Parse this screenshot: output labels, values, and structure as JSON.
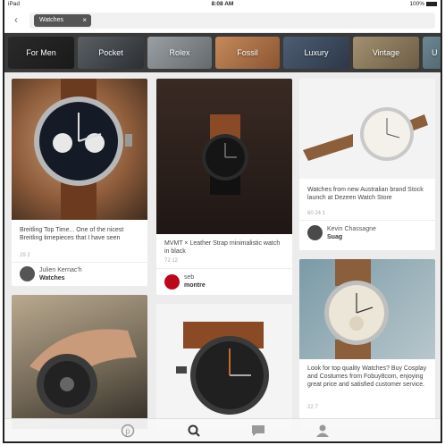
{
  "status": {
    "device": "iPad",
    "time": "8:08 AM",
    "battery": "100%"
  },
  "search": {
    "query": "Watches"
  },
  "categories": [
    "For Men",
    "Pocket",
    "Rolex",
    "Fossil",
    "Luxury",
    "Vintage",
    "U"
  ],
  "pins": [
    {
      "desc": "Breitling Top Time... One of the nicest Breitling timepieces that I have seen",
      "stats": "29  2",
      "user": "Julien Kernac'h",
      "board": "Watches"
    },
    {
      "desc": "MVMT × Leather Strap minimalistic watch in black",
      "stats": "72  12",
      "user": "seb",
      "board": "montre"
    },
    {
      "desc": "Watches from new Australian brand Stock launch at Dezeen Watch Store",
      "stats": "60  24  1",
      "user": "Kevin Chassagne",
      "board": "Suag"
    },
    {
      "desc": "Look for top quality Watches? Buy Cosplay and Costumes from Fobuy8com, enjoying great price and satisfied customer service.",
      "stats": "22  7"
    }
  ],
  "colors": {
    "accent": "#bd081c",
    "category_bar": "#3a3a3a"
  },
  "tabs": [
    "pinterest-icon",
    "search-icon",
    "messages-icon",
    "profile-icon"
  ]
}
